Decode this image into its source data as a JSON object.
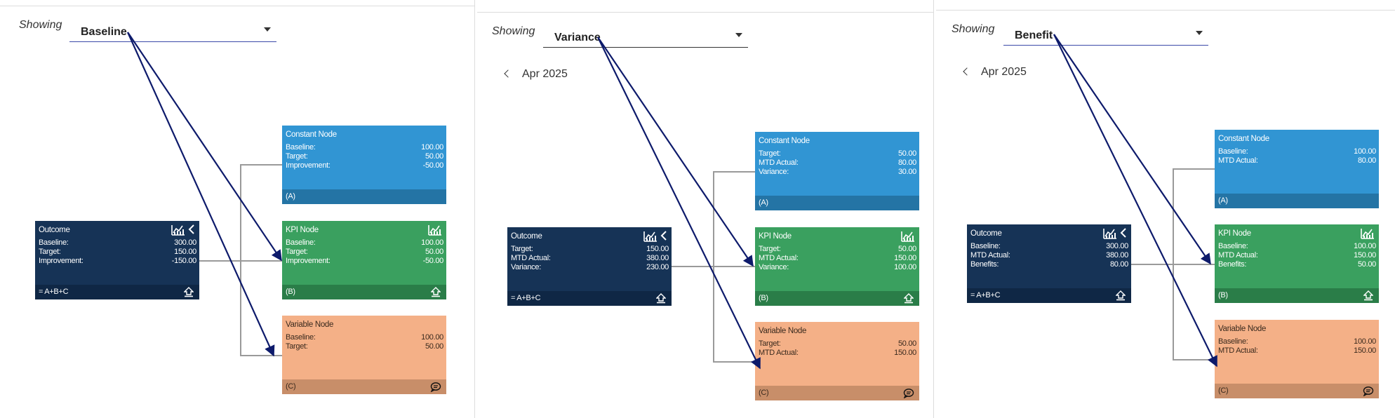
{
  "panels": [
    {
      "showing_label": "Showing",
      "selected": "Baseline",
      "month": "",
      "outcome": {
        "title": "Outcome",
        "rows": [
          [
            "Baseline:",
            "300.00"
          ],
          [
            "Target:",
            "150.00"
          ],
          [
            "Improvement:",
            "-150.00"
          ]
        ],
        "footer": "= A+B+C"
      },
      "constant": {
        "title": "Constant Node",
        "rows": [
          [
            "Baseline:",
            "100.00"
          ],
          [
            "Target:",
            "50.00"
          ],
          [
            "Improvement:",
            "-50.00"
          ]
        ],
        "footer": "(A)"
      },
      "kpi": {
        "title": "KPI Node",
        "rows": [
          [
            "Baseline:",
            "100.00"
          ],
          [
            "Target:",
            "50.00"
          ],
          [
            "Improvement:",
            "-50.00"
          ]
        ],
        "footer": "(B)"
      },
      "variable": {
        "title": "Variable Node",
        "rows": [
          [
            "Baseline:",
            "100.00"
          ],
          [
            "Target:",
            "50.00"
          ]
        ],
        "footer": "(C)"
      }
    },
    {
      "showing_label": "Showing",
      "selected": "Variance",
      "month": "Apr 2025",
      "outcome": {
        "title": "Outcome",
        "rows": [
          [
            "Target:",
            "150.00"
          ],
          [
            "MTD Actual:",
            "380.00"
          ],
          [
            "Variance:",
            "230.00"
          ]
        ],
        "footer": "= A+B+C"
      },
      "constant": {
        "title": "Constant Node",
        "rows": [
          [
            "Target:",
            "50.00"
          ],
          [
            "MTD Actual:",
            "80.00"
          ],
          [
            "Variance:",
            "30.00"
          ]
        ],
        "footer": "(A)"
      },
      "kpi": {
        "title": "KPI Node",
        "rows": [
          [
            "Target:",
            "50.00"
          ],
          [
            "MTD Actual:",
            "150.00"
          ],
          [
            "Variance:",
            "100.00"
          ]
        ],
        "footer": "(B)"
      },
      "variable": {
        "title": "Variable Node",
        "rows": [
          [
            "Target:",
            "50.00"
          ],
          [
            "MTD Actual:",
            "150.00"
          ]
        ],
        "footer": "(C)"
      }
    },
    {
      "showing_label": "Showing",
      "selected": "Benefit",
      "month": "Apr 2025",
      "outcome": {
        "title": "Outcome",
        "rows": [
          [
            "Baseline:",
            "300.00"
          ],
          [
            "MTD Actual:",
            "380.00"
          ],
          [
            "Benefits:",
            "80.00"
          ]
        ],
        "footer": "= A+B+C"
      },
      "constant": {
        "title": "Constant Node",
        "rows": [
          [
            "Baseline:",
            "100.00"
          ],
          [
            "MTD Actual:",
            "80.00"
          ]
        ],
        "footer": "(A)"
      },
      "kpi": {
        "title": "KPI Node",
        "rows": [
          [
            "Baseline:",
            "100.00"
          ],
          [
            "MTD Actual:",
            "150.00"
          ],
          [
            "Benefits:",
            "50.00"
          ]
        ],
        "footer": "(B)"
      },
      "variable": {
        "title": "Variable Node",
        "rows": [
          [
            "Baseline:",
            "100.00"
          ],
          [
            "MTD Actual:",
            "150.00"
          ]
        ],
        "footer": "(C)"
      }
    }
  ],
  "icons": {
    "chart": "line-chart-icon",
    "collapse": "chevron-left-icon",
    "upload": "upload-icon",
    "comment": "comment-icon",
    "annotation_arrows": "annotation-arrow"
  },
  "colors": {
    "outcome": "#163356",
    "constant": "#3195d3",
    "kpi": "#3aa05f",
    "variable": "#f4b087",
    "arrow": "#0d1a6b"
  }
}
